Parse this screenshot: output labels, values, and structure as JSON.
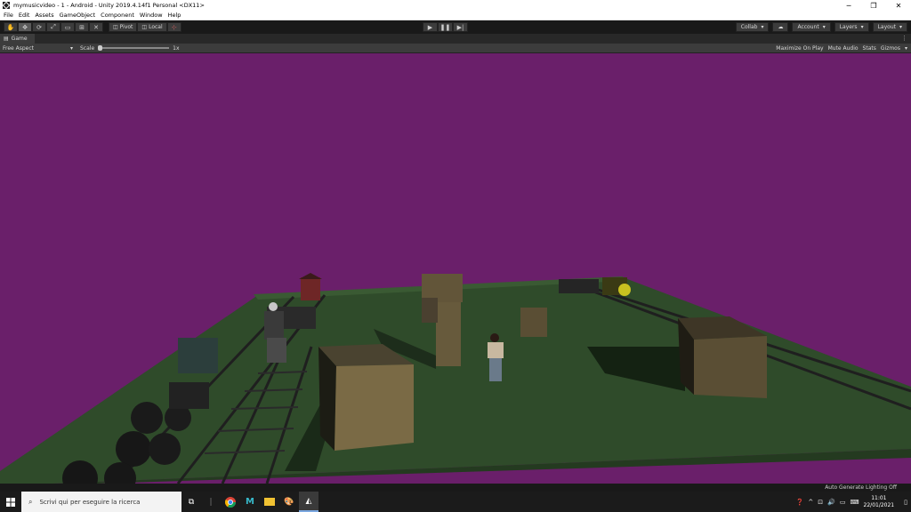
{
  "window": {
    "title": "mymusicvideo - 1 - Android - Unity 2019.4.14f1 Personal <DX11>",
    "minimize": "─",
    "restore": "❐",
    "close": "✕"
  },
  "menu": [
    "File",
    "Edit",
    "Assets",
    "GameObject",
    "Component",
    "Window",
    "Help"
  ],
  "toolbar": {
    "pivot": "Pivot",
    "local": "Local",
    "collab": "Collab",
    "account": "Account",
    "layers": "Layers",
    "layout": "Layout"
  },
  "tab": {
    "label": "Game"
  },
  "gamebar": {
    "aspect": "Free Aspect",
    "scale_label": "Scale",
    "scale_value": "1x",
    "maximize": "Maximize On Play",
    "mute": "Mute Audio",
    "stats": "Stats",
    "gizmos": "Gizmos"
  },
  "status": {
    "text": "Auto Generate Lighting Off"
  },
  "taskbar": {
    "search_placeholder": "Scrivi qui per eseguire la ricerca",
    "time": "11:01",
    "date": "22/01/2021"
  },
  "colors": {
    "sky": "#6a1f6a",
    "ground": "#2e4a2a"
  }
}
